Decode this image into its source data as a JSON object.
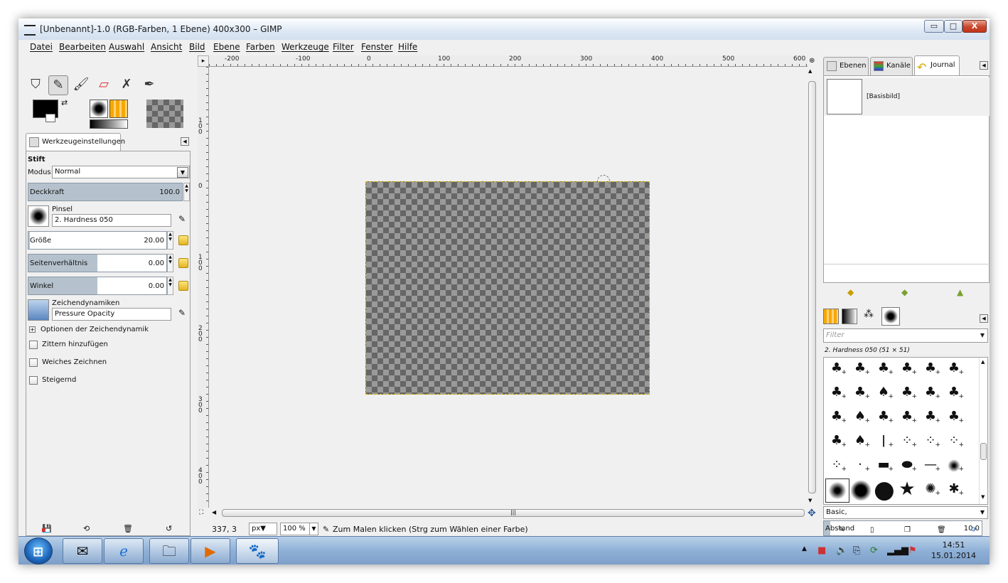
{
  "window": {
    "title": "[Unbenannt]-1.0 (RGB-Farben, 1 Ebene) 400x300 – GIMP",
    "controls": {
      "minimize": "▭",
      "maximize": "□",
      "close": "X"
    }
  },
  "menu": [
    "Datei",
    "Bearbeiten",
    "Auswahl",
    "Ansicht",
    "Bild",
    "Ebene",
    "Farben",
    "Werkzeuge",
    "Filter",
    "Fenster",
    "Hilfe"
  ],
  "tools": [
    "bucket-fill-icon",
    "pencil-icon",
    "paintbrush-icon",
    "eraser-icon",
    "airbrush-icon",
    "ink-icon"
  ],
  "tool_options": {
    "tab_label": "Werkzeugeinstellungen",
    "tool_name": "Stift",
    "mode_label": "Modus:",
    "mode_value": "Normal",
    "opacity_label": "Deckkraft",
    "opacity_value": "100.0",
    "brush_label": "Pinsel",
    "brush_value": "2. Hardness 050",
    "size_label": "Größe",
    "size_value": "20.00",
    "aspect_label": "Seitenverhältnis",
    "aspect_value": "0.00",
    "angle_label": "Winkel",
    "angle_value": "0.00",
    "dynamics_label": "Zeichendynamiken",
    "dynamics_value": "Pressure Opacity",
    "dynamics_options": "Optionen der Zeichendynamik",
    "jitter": "Zittern hinzufügen",
    "smooth": "Weiches Zeichnen",
    "incremental": "Steigernd"
  },
  "rulers": {
    "h": [
      "-200",
      "-100",
      "0",
      "100",
      "200",
      "300",
      "400",
      "500",
      "600"
    ],
    "v": [
      "100",
      "0",
      "100",
      "200",
      "300",
      "400"
    ]
  },
  "status": {
    "coords": "337, 3",
    "unit": "px",
    "zoom": "100 %",
    "message": "Zum Malen klicken (Strg zum Wählen einer Farbe)"
  },
  "dock": {
    "tabs": [
      "Ebenen",
      "Kanäle",
      "Journal"
    ],
    "history_item": "[Basisbild]",
    "filter_placeholder": "Filter",
    "brush_name": "2. Hardness 050 (51 × 51)",
    "tag_value": "Basic,",
    "spacing_label": "Abstand",
    "spacing_value": "10.0"
  },
  "taskbar": {
    "time": "14:51",
    "date": "15.01.2014"
  },
  "colors": {
    "selection_border": "#d4b800",
    "taskbar": "#8fb0d6",
    "slider_fill": "#b5c2cd"
  }
}
